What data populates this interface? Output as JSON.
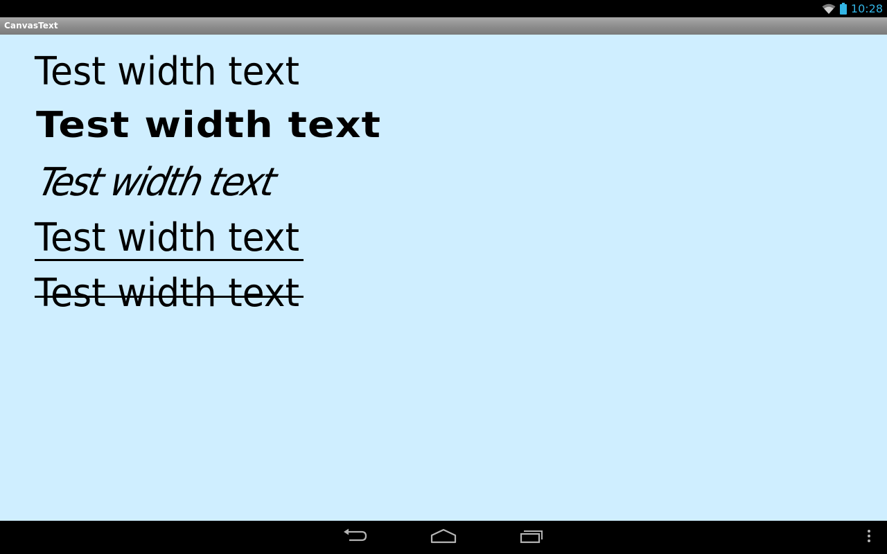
{
  "status_bar": {
    "time": "10:28",
    "icons": [
      "wifi-icon",
      "battery-icon"
    ],
    "time_color": "#33b5e5"
  },
  "app": {
    "title": "CanvasText"
  },
  "canvas": {
    "background": "#cfeeff",
    "lines": [
      {
        "text": "Test width text",
        "style": "normal"
      },
      {
        "text": "Test width text",
        "style": "bold-wide"
      },
      {
        "text": "Test width text",
        "style": "skewed"
      },
      {
        "text": "Test width text",
        "style": "underline"
      },
      {
        "text": "Test width text",
        "style": "strikethrough"
      }
    ]
  },
  "nav_bar": {
    "buttons": [
      "back-icon",
      "home-icon",
      "recents-icon",
      "overflow-menu-icon"
    ]
  }
}
